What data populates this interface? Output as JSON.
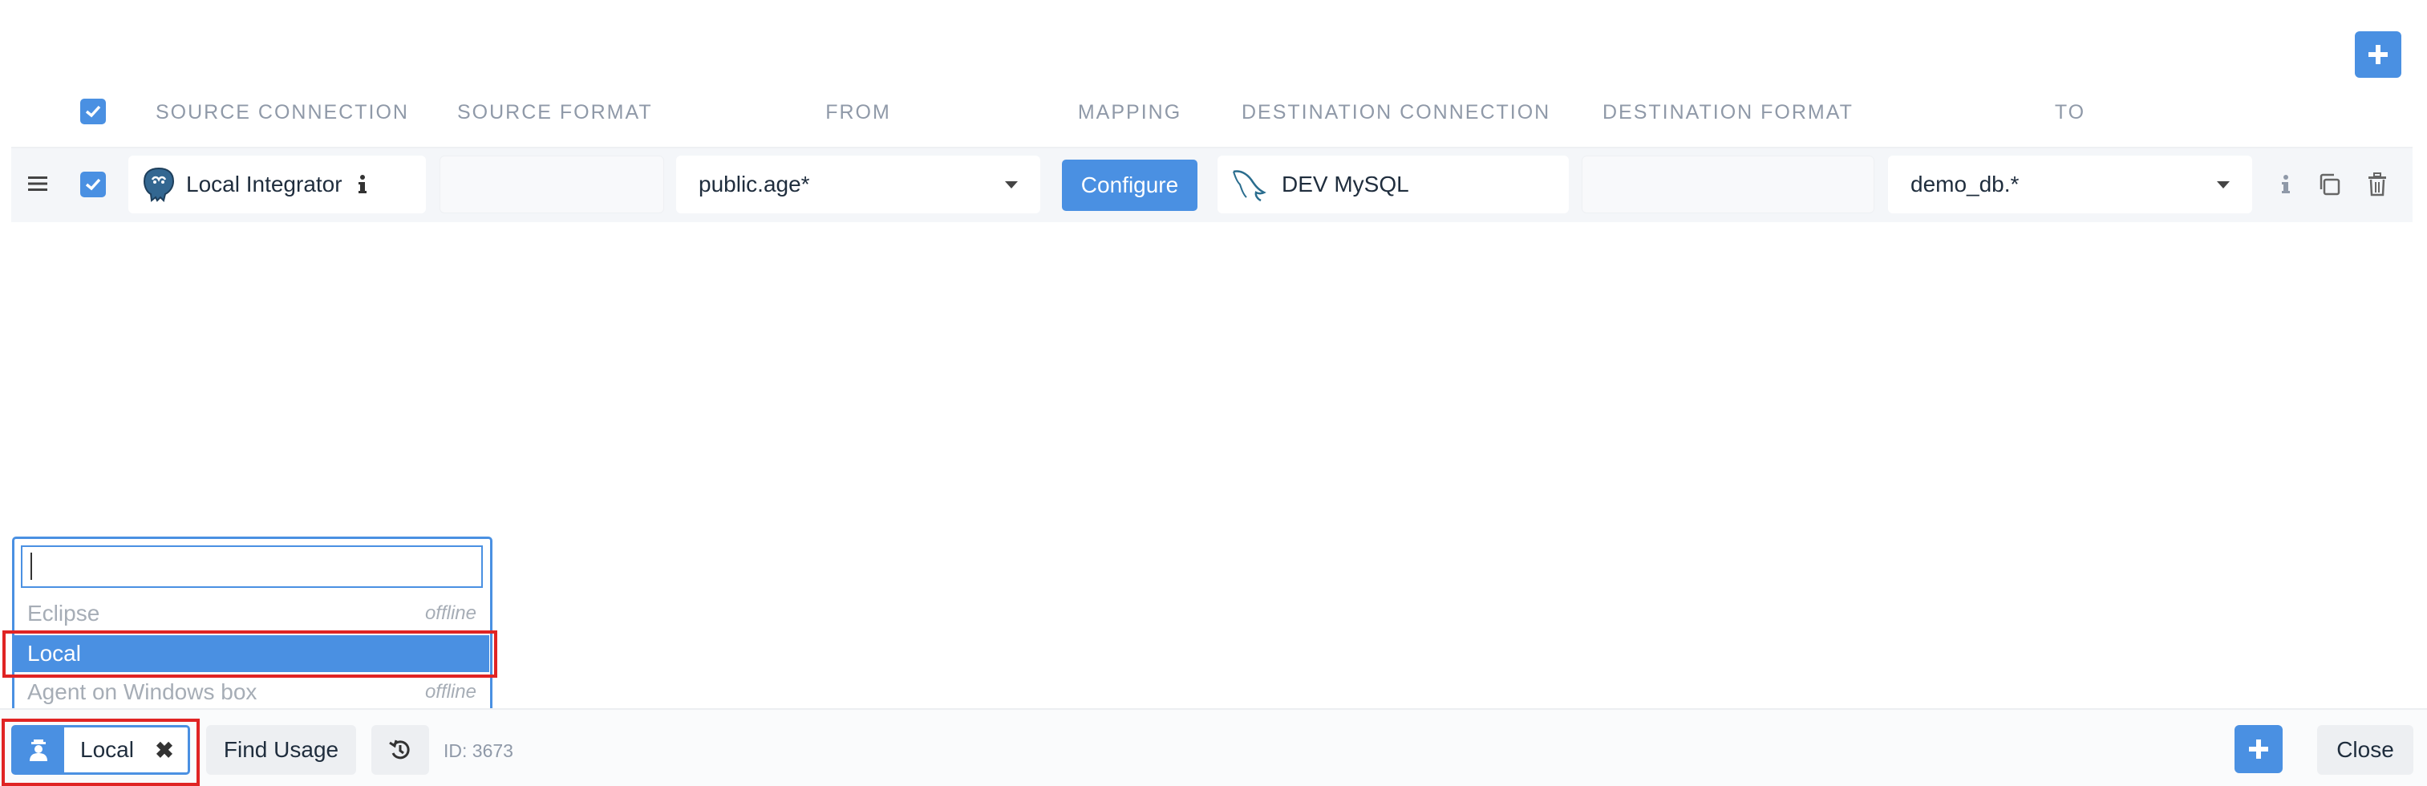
{
  "header": {
    "columns": {
      "source_connection": "SOURCE CONNECTION",
      "source_format": "SOURCE FORMAT",
      "from": "FROM",
      "mapping": "MAPPING",
      "destination_connection": "DESTINATION CONNECTION",
      "destination_format": "DESTINATION FORMAT",
      "to": "TO"
    }
  },
  "row": {
    "source_connection": "Local Integrator",
    "source_icon": "postgresql-elephant-icon",
    "from": "public.age*",
    "mapping_button": "Configure",
    "destination_connection": "DEV MySQL",
    "destination_icon": "mysql-dolphin-icon",
    "to": "demo_db.*"
  },
  "agent_dropdown": {
    "search_value": "",
    "options": [
      {
        "label": "Eclipse",
        "status": "offline"
      },
      {
        "label": "Local",
        "status": ""
      },
      {
        "label": "Agent on Windows box",
        "status": "offline"
      }
    ]
  },
  "footer": {
    "agent_selected": "Local",
    "clear_glyph": "✖",
    "find_usage": "Find Usage",
    "id_text": "ID: 3673",
    "close": "Close"
  },
  "colors": {
    "accent": "#4a90e2",
    "highlight": "#e02424"
  }
}
